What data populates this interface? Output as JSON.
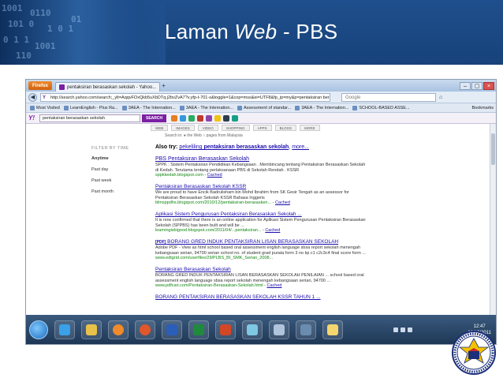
{
  "slide": {
    "title_prefix": "Laman ",
    "title_italic": "Web",
    "title_suffix": " - PBS"
  },
  "browser": {
    "firefox_button": "Firefox",
    "tab_label": "pentaksiran berasaskan sekolah - Yahoo...",
    "new_tab": "+",
    "window_controls": [
      "–",
      "▢",
      "×"
    ],
    "url": "http://search.yahoo.com/search;_ylt=AqqvFOxQkb5uXbDTq.j2bvZvA7?v.yfp-t-701-s&toggle=1&cop=mss&ei=UTF8&fp_ip=my&p=pentaksiran berasaskan sekolah",
    "google_placeholder": "Google",
    "bookmarks": [
      "Most Visited",
      "LearnEnglish - Plus Ra...",
      "3AEA - The Internation...",
      "3AEA - The Internation...",
      "Assessment of standar...",
      "3AEA - The Internation...",
      "SCHOOL-BASED ASSE..."
    ],
    "bookmarks_right": "Bookmarks"
  },
  "yahoo": {
    "logo": "Y!",
    "query": "pentaksiran berasaskan sekolah",
    "search_button": "SEARCH",
    "tabs": [
      "WEB",
      "IMAGES",
      "VIDEO",
      "SHOPPING",
      "APPS",
      "BLOGS",
      "MORE"
    ],
    "search_in": "Search in:  ● the Web  ○ pages from Malaysia",
    "filter": {
      "heading": "FILTER BY TIME",
      "items": [
        "Anytime",
        "Past day",
        "Past week",
        "Past month"
      ]
    },
    "also_try": {
      "label": "Also try:",
      "link1_pre": "pekeliling ",
      "link1_bold": "pentaksiran berasaskan sekolah",
      "sep": ",",
      "link2": "more..."
    },
    "results": [
      {
        "format": "",
        "title": "PBS Pentaksiran Berasaskan Sekolah",
        "snippet": "SPPK : Sistem Pentaksiran Pendidikan Kebangsaan . Membincang tentang Pentaksiran Berasaskan Sekolah di Kedah. Terutama tentang perlaksanaan PBS di Sekolah Rendah . KSSR",
        "url": "sppkkedah.blogspot.com",
        "cached": "Cached"
      },
      {
        "format": "",
        "title": "Pentaksiran Berasaskan Sekolah KSSR",
        "snippet": "We are proud to have Encik Badrulisham bin Mohd Ibrahim from SK Gesir Tengah as an assessor for Pentaksiran Berasaskan Sekolah KSSR Bahasa Inggeris",
        "url": "blmsppdhs.blogspot.com/2010/12/pentaksiran-berasasken...",
        "cached": "Cached"
      },
      {
        "format": "",
        "title": "Aplikasi Sistem Pengurusan Pentaksiran Berasaskan Sekolah ...",
        "snippet": "It is now confirmed that there is an online application for Aplikasi Sistem Pengurusan Pentaksiran Berasaskan Sekolah (SPPBS) has been built and will be ...",
        "url": "learningisbigood.blogspot.com/2011/04/...pentaksiran...",
        "cached": "Cached"
      },
      {
        "format": "[PDF]",
        "title": "BORANG GRED INDUK PENTAKSIRAN LISAN BERASASKAN SEKOLAH",
        "snippet": "Adobe PDF - View as html  school based oral assessment english language sbsa report sekolah menengah kebangsaan serian, 94700 serian school no. of student grad purata form 3 no kp c1 c2c3c4 final score form ...",
        "url": "www.edtgrid.com/userfiles/29/PLBS_BI_SMK_Serian_2008...",
        "cached": ""
      },
      {
        "format": "",
        "title": "Pentaksiran Berasaskan Sekolah",
        "snippet": "BORANG GRED INDUK PENTAKSIRAN LISAN BERASASKAN SEKOLAH PENILAIAN ... school based oral assessment english language sbsa report sekolah menengah kebangsaan serian, 94700 ...",
        "url": "www.pdfcari.com/Pentaksiran-Berasaskan-Sekolah.html",
        "cached": "Cached"
      },
      {
        "format": "",
        "title": "BORANG PENTAKSIRAN BERASASKAN SEKOLAH KSSR TAHUN 1 ...",
        "snippet": "",
        "url": "",
        "cached": ""
      }
    ]
  },
  "taskbar": {
    "time": "12:47",
    "date": "12/10/2011"
  },
  "colors": {
    "header_blue": "#1f4f8c",
    "link_blue": "#1a0dab",
    "url_green": "#118811",
    "yahoo_purple": "#7b1fa2"
  }
}
